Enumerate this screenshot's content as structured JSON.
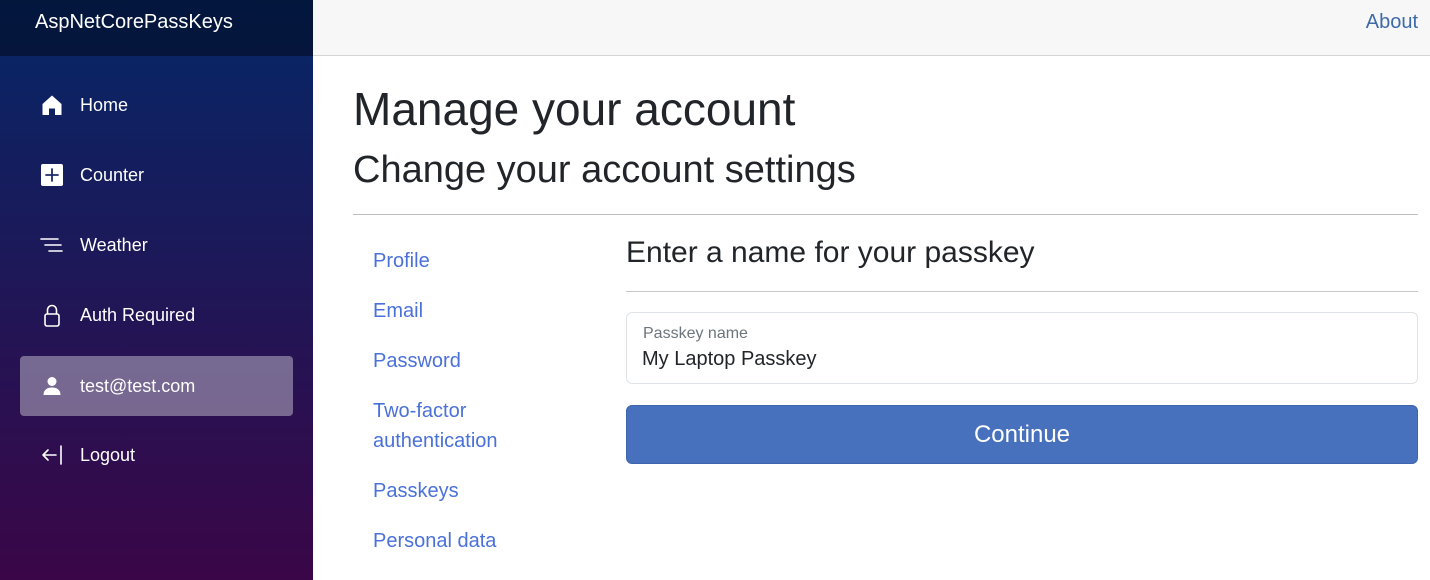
{
  "app": {
    "brand": "AspNetCorePassKeys",
    "about_label": "About"
  },
  "sidebar": {
    "items": [
      {
        "label": "Home",
        "icon": "home-icon"
      },
      {
        "label": "Counter",
        "icon": "plus-square-icon"
      },
      {
        "label": "Weather",
        "icon": "list-lines-icon"
      },
      {
        "label": "Auth Required",
        "icon": "lock-icon"
      },
      {
        "label": "test@test.com",
        "icon": "person-icon",
        "active": true
      },
      {
        "label": "Logout",
        "icon": "logout-arrow-icon"
      }
    ]
  },
  "page": {
    "title": "Manage your account",
    "subtitle": "Change your account settings"
  },
  "account_nav": {
    "items": [
      {
        "label": "Profile"
      },
      {
        "label": "Email"
      },
      {
        "label": "Password"
      },
      {
        "label": "Two-factor authentication"
      },
      {
        "label": "Passkeys"
      },
      {
        "label": "Personal data"
      }
    ]
  },
  "form": {
    "heading": "Enter a name for your passkey",
    "field_label": "Passkey name",
    "field_value": "My Laptop Passkey",
    "continue_label": "Continue"
  },
  "colors": {
    "sidebar_top": "#052767",
    "sidebar_bottom": "#3a0647",
    "link": "#4a71d9",
    "button": "#4770bd"
  }
}
